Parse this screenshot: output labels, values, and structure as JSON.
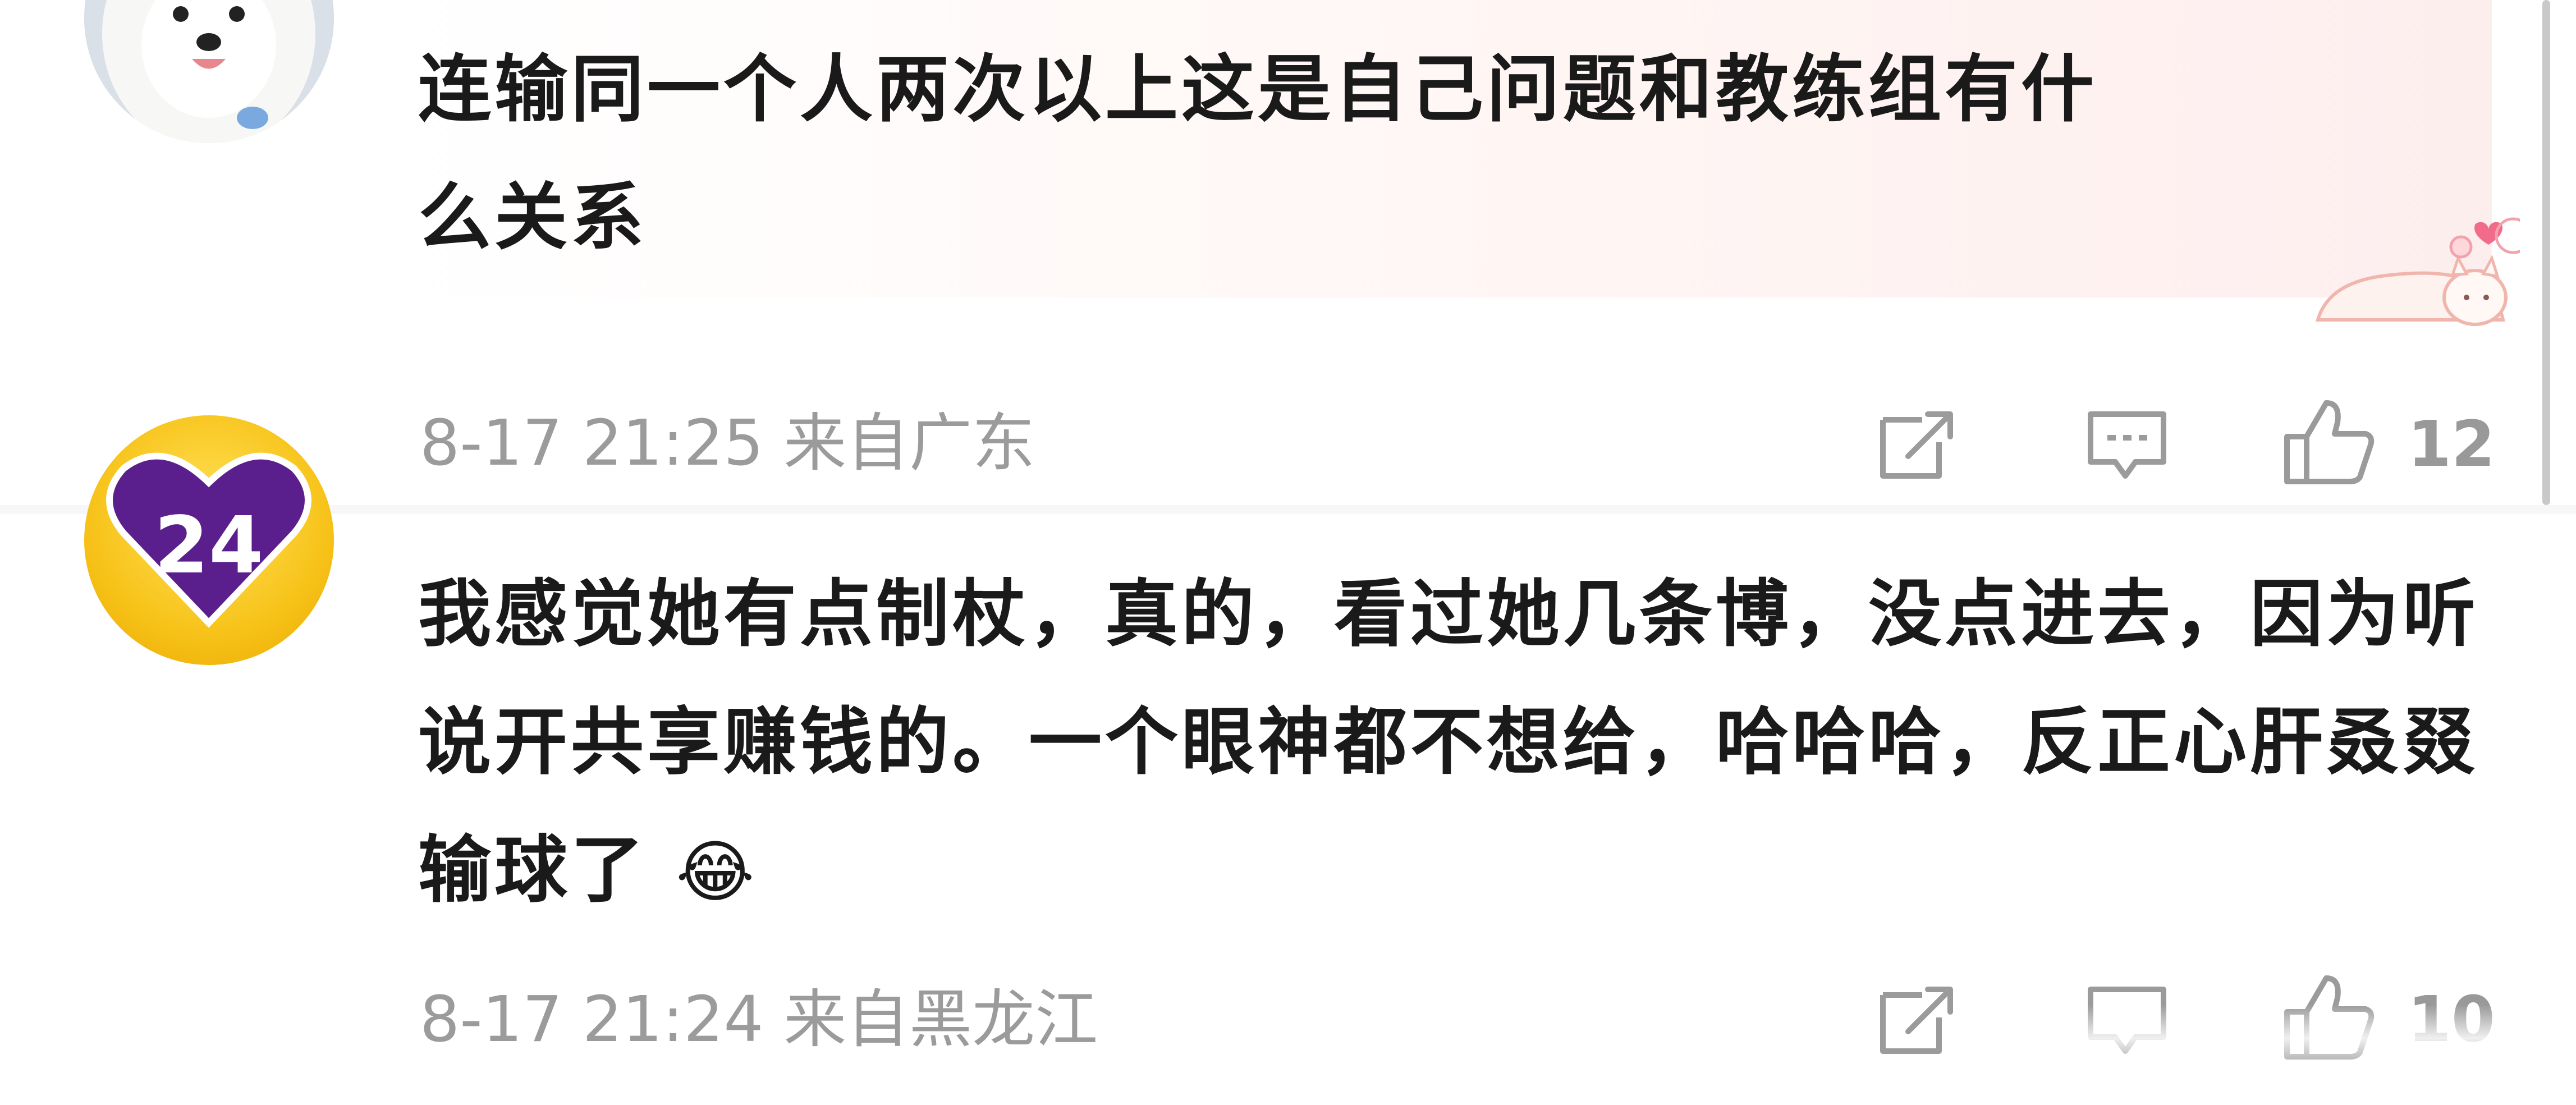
{
  "comments": [
    {
      "avatar": "samoyed-dog-photo",
      "text": "连输同一个人两次以上这是自己问题和教练组有什\n么关系",
      "time": "8-17 21:25",
      "location": "来自广东",
      "likes": "12"
    },
    {
      "avatar": "purple-24-heart-badge",
      "avatar_badge": "24",
      "text": "我感觉她有点制杖，真的，看过她几条博，没点进去，因为听说开共享赚钱的。一个眼神都不想给，哈哈哈，反正心肝叒叕输球了",
      "emoji": "😂",
      "time": "8-17 21:24",
      "location": "来自黑龙江",
      "likes": "10"
    }
  ],
  "icons": {
    "share": "share-icon",
    "reply": "comment-icon",
    "like": "thumbs-up-icon"
  },
  "colors": {
    "text": "#1a1a1a",
    "meta": "#9b9b9b",
    "bubble": "#fff3f1",
    "avatar2": "#f7c31a",
    "heart": "#5a1f8c"
  }
}
